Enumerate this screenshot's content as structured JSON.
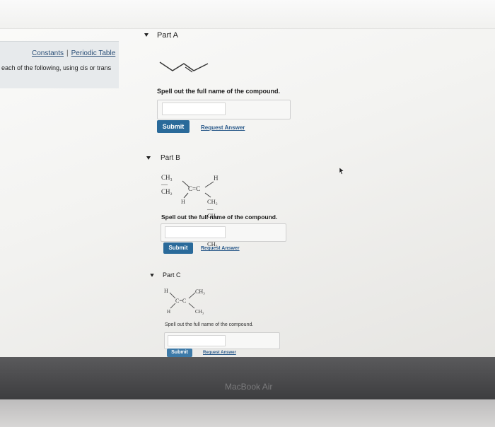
{
  "sidebar": {
    "constants_link": "Constants",
    "separator": "|",
    "periodic_table_link": "Periodic Table",
    "instruction": "each of the following, using cis or trans"
  },
  "parts": [
    {
      "title": "Part A",
      "prompt": "Spell out the full name of the compound.",
      "submit": "Submit",
      "request": "Request Answer",
      "answer_value": ""
    },
    {
      "title": "Part B",
      "prompt": "Spell out the full name of the compound.",
      "submit": "Submit",
      "request": "Request Answer",
      "answer_value": "",
      "structure": {
        "top_left": "CH₃—CH₂",
        "top_right": "H",
        "center": "C=C",
        "bottom_left": "H",
        "bottom_right": "CH₂—CH₂—CH₂—CH₃"
      }
    },
    {
      "title": "Part C",
      "prompt": "Spell out the full name of the compound.",
      "submit": "Submit",
      "request": "Request Answer",
      "answer_value": "",
      "structure": {
        "top_left": "H",
        "top_right": "CH₃",
        "center": "C=C",
        "bottom_left": "H",
        "bottom_right": "CH₃"
      }
    }
  ],
  "device": {
    "brand": "MacBook Air"
  },
  "colors": {
    "submit_bg": "#2a6a9a",
    "link": "#2b5a8a",
    "panel": "#e7eaec"
  }
}
